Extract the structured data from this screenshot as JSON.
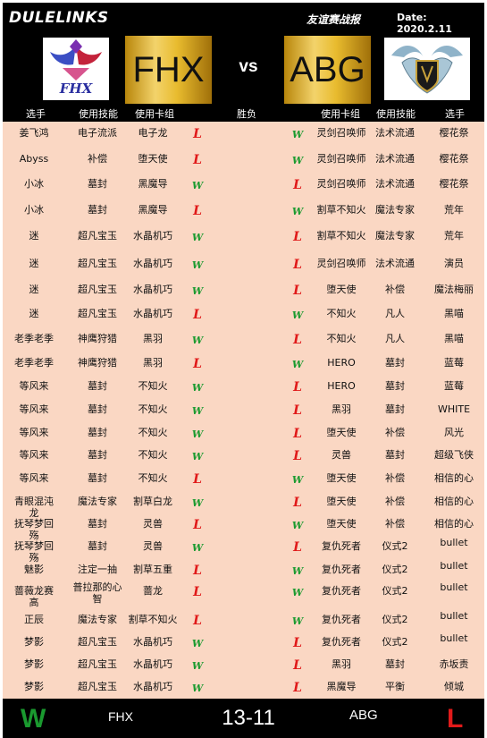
{
  "topbar": {
    "brand": "DULELINKS",
    "subtitle": "友谊赛战报",
    "date": "Date:  2020.2.11"
  },
  "teams": {
    "left": "FHX",
    "vs": "vs",
    "right": "ABG"
  },
  "logos": {
    "left_icon": "fhx-phoenix-logo",
    "right_icon": "abg-dragon-shield-logo",
    "left_logo_text": "FHX"
  },
  "columns": [
    "选手",
    "使用技能",
    "使用卡组",
    "胜负",
    "使用卡组",
    "使用技能",
    "选手"
  ],
  "marks": {
    "win": "W",
    "lose": "L",
    "win_color": "#1a9a2f",
    "lose_color": "#e01a1a"
  },
  "rows": [
    {
      "lp": "姜飞鸿",
      "ls": "电子流派",
      "ld": "电子龙",
      "lr": "L",
      "rr": "W",
      "rd": "灵剑召唤师",
      "rs": "法术流通",
      "rp": "樱花祭"
    },
    {
      "lp": "Abyss",
      "ls": "补偿",
      "ld": "堕天使",
      "lr": "L",
      "rr": "W",
      "rd": "灵剑召唤师",
      "rs": "法术流通",
      "rp": "樱花祭"
    },
    {
      "lp": "小冰",
      "ls": "墓封",
      "ld": "黑魔导",
      "lr": "W",
      "rr": "L",
      "rd": "灵剑召唤师",
      "rs": "法术流通",
      "rp": "樱花祭"
    },
    {
      "lp": "小冰",
      "ls": "墓封",
      "ld": "黑魔导",
      "lr": "L",
      "rr": "W",
      "rd": "割草不知火",
      "rs": "魔法专家",
      "rp": "荒年"
    },
    {
      "lp": "迷",
      "ls": "超凡宝玉",
      "ld": "水晶机巧",
      "lr": "W",
      "rr": "L",
      "rd": "割草不知火",
      "rs": "魔法专家",
      "rp": "荒年"
    },
    {
      "lp": "迷",
      "ls": "超凡宝玉",
      "ld": "水晶机巧",
      "lr": "W",
      "rr": "L",
      "rd": "灵剑召唤师",
      "rs": "法术流通",
      "rp": "演员"
    },
    {
      "lp": "迷",
      "ls": "超凡宝玉",
      "ld": "水晶机巧",
      "lr": "W",
      "rr": "L",
      "rd": "堕天使",
      "rs": "补偿",
      "rp": "魔法梅丽"
    },
    {
      "lp": "迷",
      "ls": "超凡宝玉",
      "ld": "水晶机巧",
      "lr": "L",
      "rr": "W",
      "rd": "不知火",
      "rs": "凡人",
      "rp": "黑喵"
    },
    {
      "lp": "老季老季",
      "ls": "神鹰狩猎",
      "ld": "黑羽",
      "lr": "W",
      "rr": "L",
      "rd": "不知火",
      "rs": "凡人",
      "rp": "黑喵"
    },
    {
      "lp": "老季老季",
      "ls": "神鹰狩猎",
      "ld": "黑羽",
      "lr": "L",
      "rr": "W",
      "rd": "HERO",
      "rs": "墓封",
      "rp": "蓝莓"
    },
    {
      "lp": "等风来",
      "ls": "墓封",
      "ld": "不知火",
      "lr": "W",
      "rr": "L",
      "rd": "HERO",
      "rs": "墓封",
      "rp": "蓝莓"
    },
    {
      "lp": "等风来",
      "ls": "墓封",
      "ld": "不知火",
      "lr": "W",
      "rr": "L",
      "rd": "黑羽",
      "rs": "墓封",
      "rp": "WHITE"
    },
    {
      "lp": "等风来",
      "ls": "墓封",
      "ld": "不知火",
      "lr": "W",
      "rr": "L",
      "rd": "堕天使",
      "rs": "补偿",
      "rp": "风光"
    },
    {
      "lp": "等风来",
      "ls": "墓封",
      "ld": "不知火",
      "lr": "W",
      "rr": "L",
      "rd": "灵兽",
      "rs": "墓封",
      "rp": "超级飞侠"
    },
    {
      "lp": "等风来",
      "ls": "墓封",
      "ld": "不知火",
      "lr": "L",
      "rr": "W",
      "rd": "堕天使",
      "rs": "补偿",
      "rp": "相信的心"
    },
    {
      "lp": "青眼混沌龙",
      "ls": "魔法专家",
      "ld": "割草白龙",
      "lr": "W",
      "rr": "L",
      "rd": "堕天使",
      "rs": "补偿",
      "rp": "相信的心"
    },
    {
      "lp": "抚琴梦回殇",
      "ls": "墓封",
      "ld": "灵兽",
      "lr": "L",
      "rr": "W",
      "rd": "堕天使",
      "rs": "补偿",
      "rp": "相信的心"
    },
    {
      "lp": "抚琴梦回殇",
      "ls": "墓封",
      "ld": "灵兽",
      "lr": "W",
      "rr": "L",
      "rd": "复仇死者",
      "rs": "仪式2",
      "rp": "bullet"
    },
    {
      "lp": "魅影",
      "ls": "注定一抽",
      "ld": "割草五重",
      "lr": "L",
      "rr": "W",
      "rd": "复仇死者",
      "rs": "仪式2",
      "rp": "bullet"
    },
    {
      "lp": "蔷薇龙赛高",
      "ls": "普拉那的心智",
      "ld": "蔷龙",
      "lr": "L",
      "rr": "W",
      "rd": "复仇死者",
      "rs": "仪式2",
      "rp": "bullet"
    },
    {
      "lp": "正辰",
      "ls": "魔法专家",
      "ld": "割草不知火",
      "lr": "L",
      "rr": "W",
      "rd": "复仇死者",
      "rs": "仪式2",
      "rp": "bullet"
    },
    {
      "lp": "梦影",
      "ls": "超凡宝玉",
      "ld": "水晶机巧",
      "lr": "W",
      "rr": "L",
      "rd": "复仇死者",
      "rs": "仪式2",
      "rp": "bullet"
    },
    {
      "lp": "梦影",
      "ls": "超凡宝玉",
      "ld": "水晶机巧",
      "lr": "W",
      "rr": "L",
      "rd": "黑羽",
      "rs": "墓封",
      "rp": "赤坂责"
    },
    {
      "lp": "梦影",
      "ls": "超凡宝玉",
      "ld": "水晶机巧",
      "lr": "W",
      "rr": "L",
      "rd": "黑魔导",
      "rs": "平衡",
      "rp": "倾城"
    }
  ],
  "footer": {
    "left_result": "W",
    "left_team": "FHX",
    "score": "13-11",
    "right_team": "ABG",
    "right_result": "L"
  }
}
